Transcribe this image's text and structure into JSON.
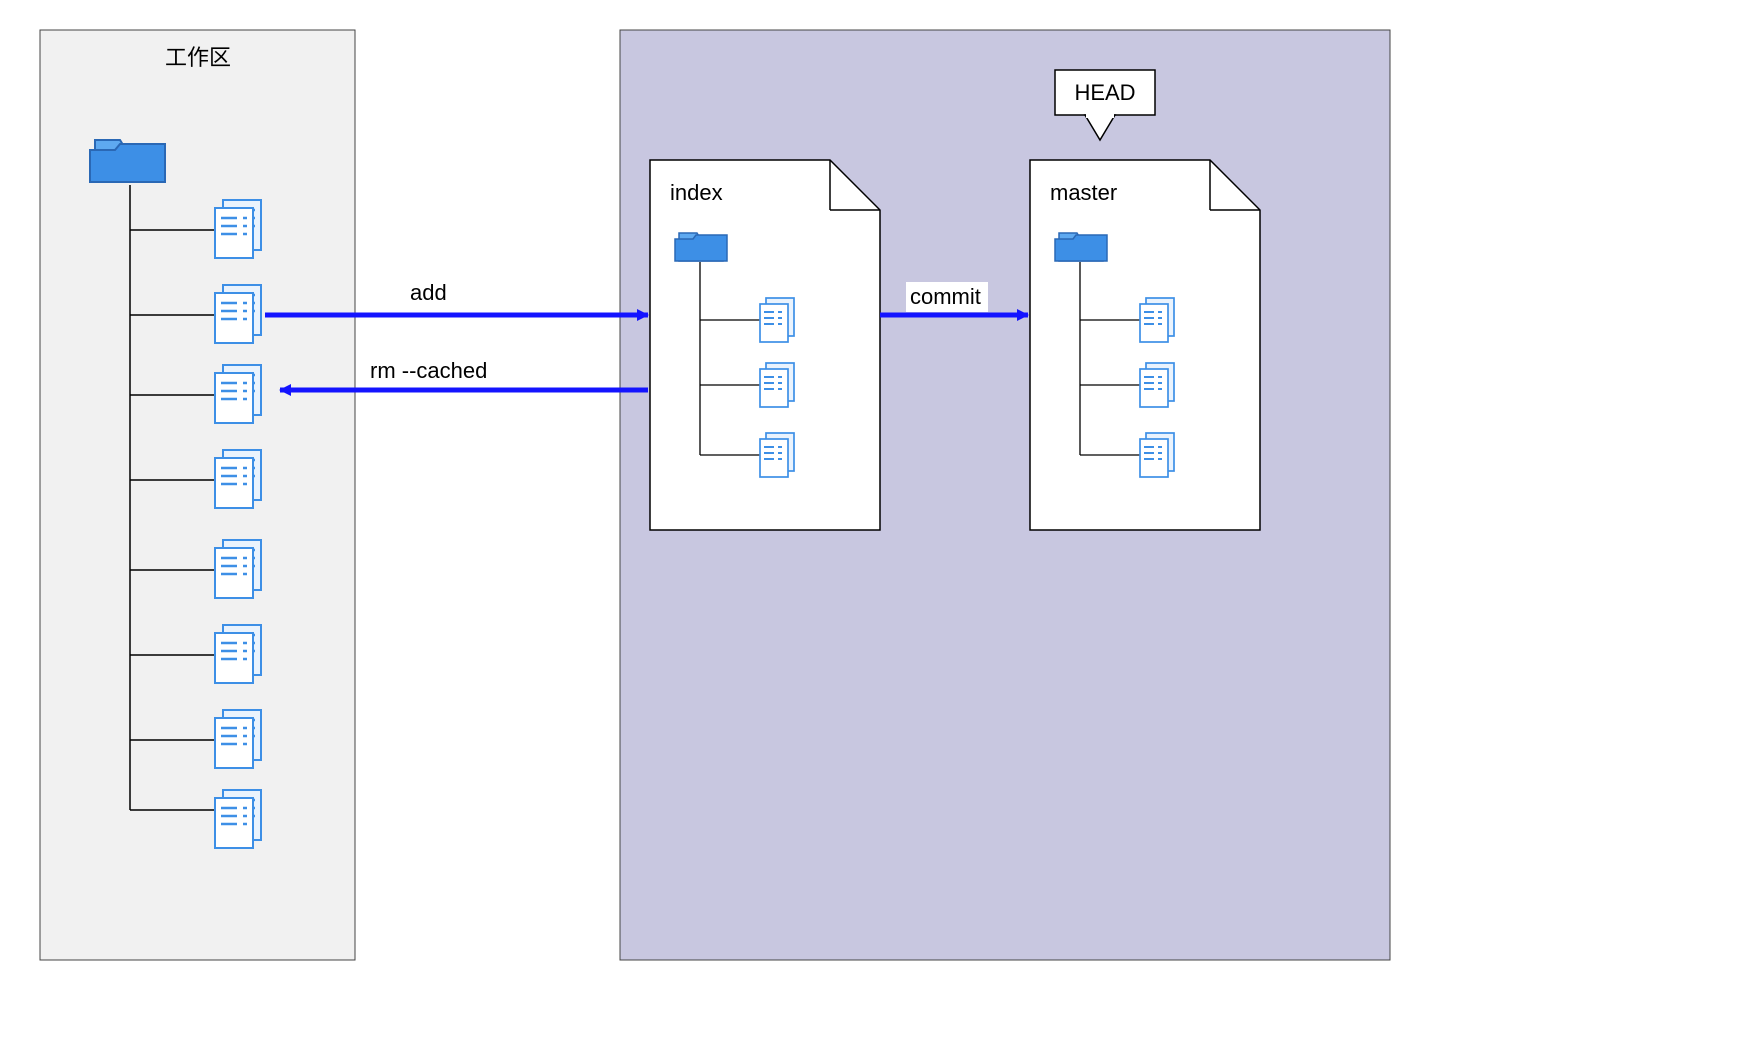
{
  "diagram": {
    "working_area_title": "工作区",
    "index_title": "index",
    "master_title": "master",
    "head_label": "HEAD",
    "arrow_add": "add",
    "arrow_rm": "rm --cached",
    "arrow_commit": "commit"
  },
  "colors": {
    "arrow_blue": "#1414ff",
    "icon_blue1": "#1e88e5",
    "icon_blue2": "#64b5f6",
    "icon_blue3": "#90caf9",
    "icon_stroke": "#2a68b5",
    "repo_bg": "#c8c7e0",
    "work_bg": "#f1f1f1",
    "border_gray": "#444444"
  }
}
